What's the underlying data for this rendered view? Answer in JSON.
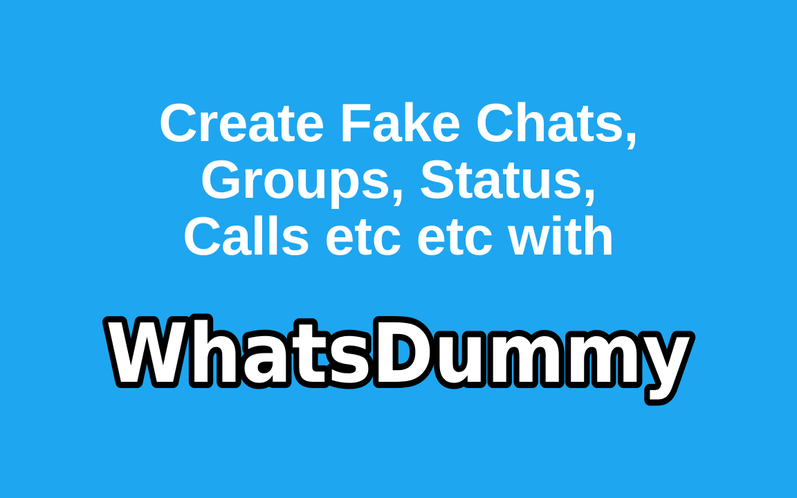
{
  "headline": {
    "lines": [
      "Create Fake Chats,",
      "Groups, Status,",
      "Calls etc etc with"
    ]
  },
  "brand": {
    "name": "WhatsDummy"
  },
  "colors": {
    "background": "#1EA6F0",
    "headline_text": "#FFFFFF",
    "logo_fill": "#FFFFFF",
    "logo_outline": "#000000"
  }
}
